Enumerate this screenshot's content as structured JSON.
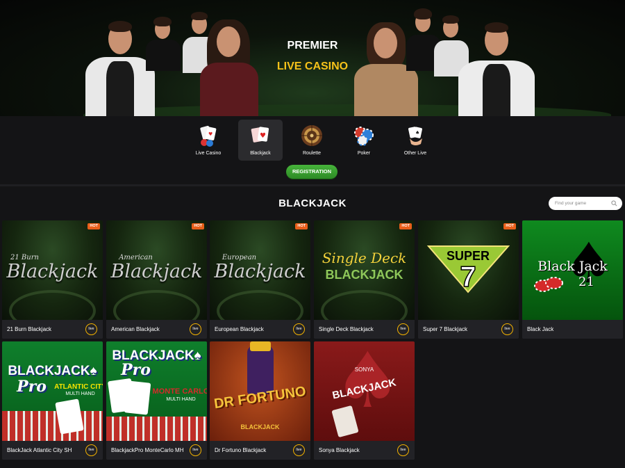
{
  "hero": {
    "line1": "PREMIER",
    "line2": "LIVE CASINO"
  },
  "categories": [
    {
      "label": "Live Casino",
      "icon": "cards-chips-icon",
      "active": false
    },
    {
      "label": "Blackjack",
      "icon": "blackjack-cards-icon",
      "active": true
    },
    {
      "label": "Roulette",
      "icon": "roulette-wheel-icon",
      "active": false
    },
    {
      "label": "Poker",
      "icon": "poker-chips-icon",
      "active": false
    },
    {
      "label": "Other Live",
      "icon": "hand-cards-icon",
      "active": false
    }
  ],
  "registration_label": "REGISTRATION",
  "section_title": "BLACKJACK",
  "search": {
    "placeholder": "Find your game"
  },
  "live_label": "live",
  "hot_label": "HOT",
  "games": [
    {
      "name": "21 Burn Blackjack",
      "art": "21 Burn Blackjack",
      "hot": true
    },
    {
      "name": "American Blackjack",
      "art": "American Blackjack",
      "hot": true
    },
    {
      "name": "European Blackjack",
      "art": "European Blackjack",
      "hot": true
    },
    {
      "name": "Single Deck Blackjack",
      "art": "Single Deck Blackjack",
      "hot": true
    },
    {
      "name": "Super 7 Blackjack",
      "art": "Super 7",
      "hot": true
    },
    {
      "name": "Black Jack",
      "art": "Black Jack 21",
      "hot": false
    },
    {
      "name": "BlackJack Atlantic City SH",
      "art": "Blackjack Pro Atlantic City Multi Hand",
      "hot": false
    },
    {
      "name": "BlackjackPro MonteCarlo MH",
      "art": "Blackjack Pro Monte Carlo Multi Hand",
      "hot": false
    },
    {
      "name": "Dr Fortuno Blackjack",
      "art": "Dr Fortuno Blackjack",
      "hot": false
    },
    {
      "name": "Sonya Blackjack",
      "art": "Sonya Blackjack",
      "hot": false
    }
  ],
  "colors": {
    "accent_yellow": "#f6c21a",
    "live_ring": "#f3b200",
    "registration_green": "#3ea632",
    "hot_badge": "#e85f1a"
  }
}
